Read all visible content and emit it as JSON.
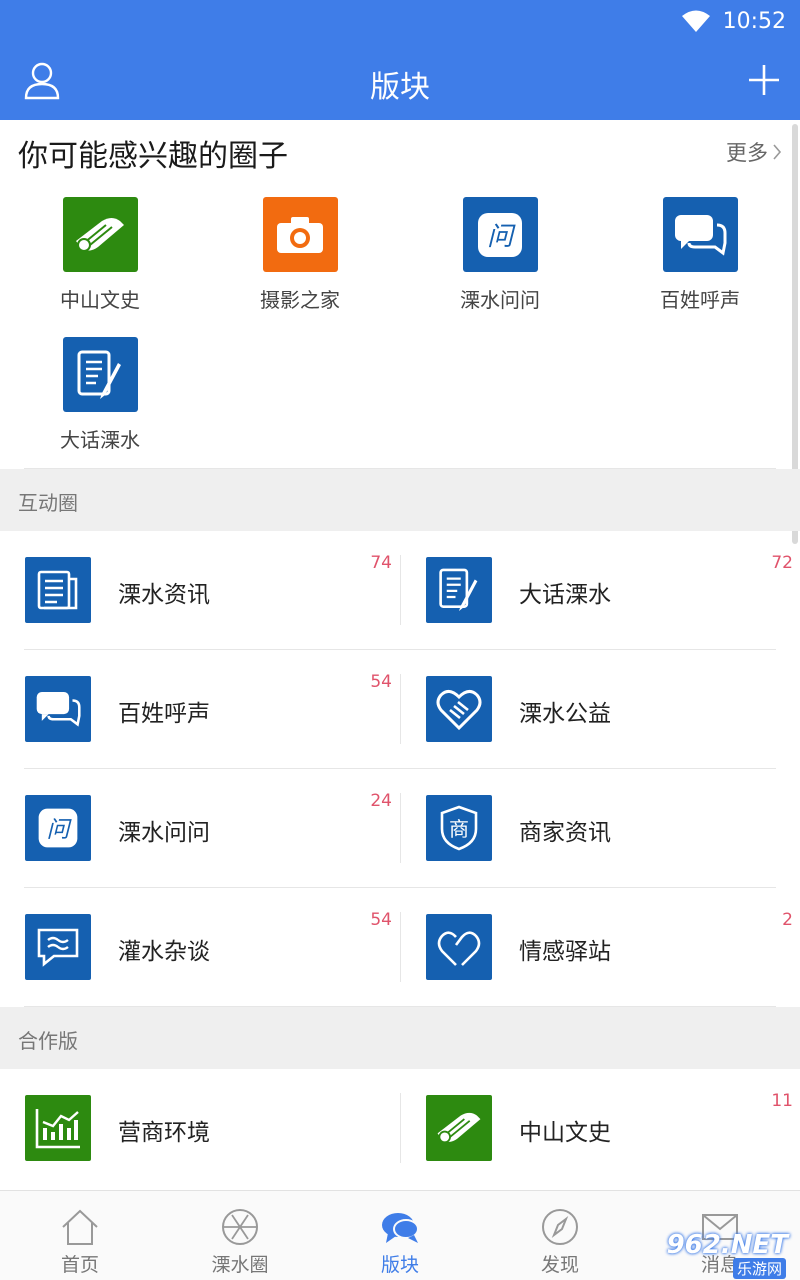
{
  "status": {
    "time": "10:52"
  },
  "header": {
    "title": "版块"
  },
  "recommended": {
    "title": "你可能感兴趣的圈子",
    "more": "更多",
    "items": [
      {
        "label": "中山文史",
        "icon": "scroll-icon",
        "color": "#2d8a10"
      },
      {
        "label": "摄影之家",
        "icon": "camera-icon",
        "color": "#f26b10"
      },
      {
        "label": "溧水问问",
        "icon": "question-bubble-icon",
        "color": "#1560b0"
      },
      {
        "label": "百姓呼声",
        "icon": "chat-bubbles-icon",
        "color": "#1560b0"
      },
      {
        "label": "大话溧水",
        "icon": "document-pen-icon",
        "color": "#1560b0"
      }
    ]
  },
  "sections": [
    {
      "title": "互动圈",
      "items": [
        {
          "label": "溧水资讯",
          "count": "74",
          "icon": "newspaper-icon"
        },
        {
          "label": "大话溧水",
          "count": "72",
          "icon": "document-pen-icon"
        },
        {
          "label": "百姓呼声",
          "count": "54",
          "icon": "chat-bubbles-icon"
        },
        {
          "label": "溧水公益",
          "count": "",
          "icon": "heart-hands-icon"
        },
        {
          "label": "溧水问问",
          "count": "24",
          "icon": "question-bubble-icon"
        },
        {
          "label": "商家资讯",
          "count": "",
          "icon": "shop-shield-icon"
        },
        {
          "label": "灌水杂谈",
          "count": "54",
          "icon": "wave-bubble-icon"
        },
        {
          "label": "情感驿站",
          "count": "2",
          "icon": "heart-icon"
        }
      ]
    },
    {
      "title": "合作版",
      "items": [
        {
          "label": "营商环境",
          "count": "",
          "icon": "bar-chart-icon"
        },
        {
          "label": "中山文史",
          "count": "11",
          "icon": "scroll-icon"
        }
      ]
    }
  ],
  "bottom_nav": [
    {
      "label": "首页",
      "icon": "home-icon",
      "active": false
    },
    {
      "label": "溧水圈",
      "icon": "aperture-icon",
      "active": false
    },
    {
      "label": "版块",
      "icon": "chat-icon",
      "active": true
    },
    {
      "label": "发现",
      "icon": "compass-icon",
      "active": false
    },
    {
      "label": "消息",
      "icon": "mail-icon",
      "active": false
    }
  ],
  "watermark": {
    "big": "962.NET",
    "small": "乐游网"
  },
  "colors": {
    "accent": "#3f7de8",
    "tile_blue": "#1560b0",
    "tile_green": "#2d8a10",
    "tile_orange": "#f26b10",
    "count_red": "#e0536b"
  }
}
